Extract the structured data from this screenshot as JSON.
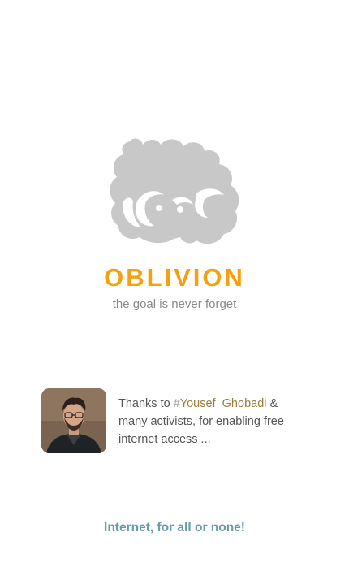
{
  "app": {
    "name": "OBLIVION",
    "tagline": "the goal is never forget",
    "logo_icon": "cartoon-face-logo-icon"
  },
  "credit": {
    "avatar_icon": "person-avatar",
    "prefix": "Thanks to ",
    "hash_symbol": "#",
    "mention": "Yousef_Ghobadi",
    "suffix": " & many activists, for enabling free internet access ..."
  },
  "footer": {
    "slogan": "Internet, for all or none!"
  },
  "colors": {
    "brand": "#f5a00f",
    "tagline": "#8a8a8a",
    "mention": "#9c7b3e",
    "slogan": "#6a9ca6",
    "logo": "#c8c8c8"
  }
}
